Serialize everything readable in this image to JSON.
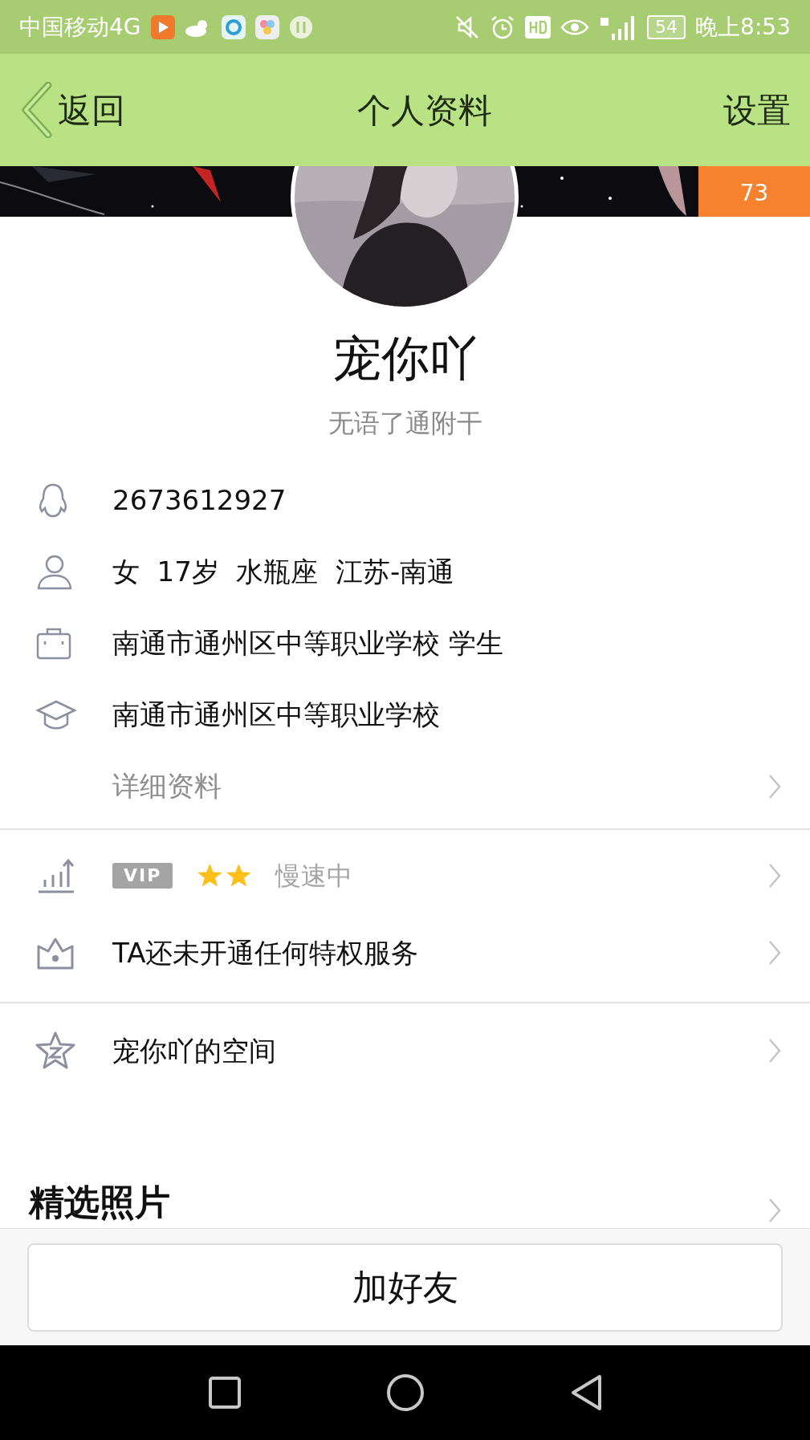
{
  "status_bar": {
    "carrier": "中国移动4G",
    "battery": "54",
    "time": "晚上8:53"
  },
  "header": {
    "back": "返回",
    "title": "个人资料",
    "settings": "设置"
  },
  "cover": {
    "badge": "73"
  },
  "profile": {
    "name": "宠你吖",
    "signature": "无语了通附干"
  },
  "info_rows": [
    {
      "kind": "qq",
      "text": "2673612927"
    },
    {
      "kind": "person",
      "text": "女  17岁  水瓶座  江苏-南通"
    },
    {
      "kind": "job",
      "text": "南通市通州区中等职业学校 学生"
    },
    {
      "kind": "school",
      "text": "南通市通州区中等职业学校"
    }
  ],
  "details_link": "详细资料",
  "level_row": {
    "badge": "VIP",
    "level_icons": [
      {
        "kind": "star"
      },
      {
        "kind": "star"
      }
    ],
    "status": "慢速中"
  },
  "privilege_row": "TA还未开通任何特权服务",
  "space_row": "宠你吖的空间",
  "photos_heading": "精选照片",
  "add_friend": "加好友"
}
